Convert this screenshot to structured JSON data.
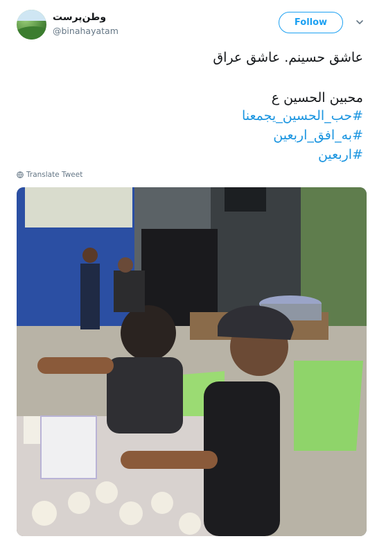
{
  "author": {
    "display_name": "وطن‌پرست",
    "handle": "@binahayatam"
  },
  "actions": {
    "follow_label": "Follow",
    "menu_icon": "chevron-down-icon"
  },
  "tweet": {
    "line1": "عاشق حسینم. عاشق عراق",
    "line2": "محبین الحسین ع",
    "hashtags": [
      "#حب_الحسين_يجمعنا",
      "#به_افق_اربعین",
      "#اربعین"
    ]
  },
  "translate_label": "Translate Tweet",
  "colors": {
    "link": "#1b95e0",
    "follow": "#1da1f2",
    "muted": "#657786"
  }
}
